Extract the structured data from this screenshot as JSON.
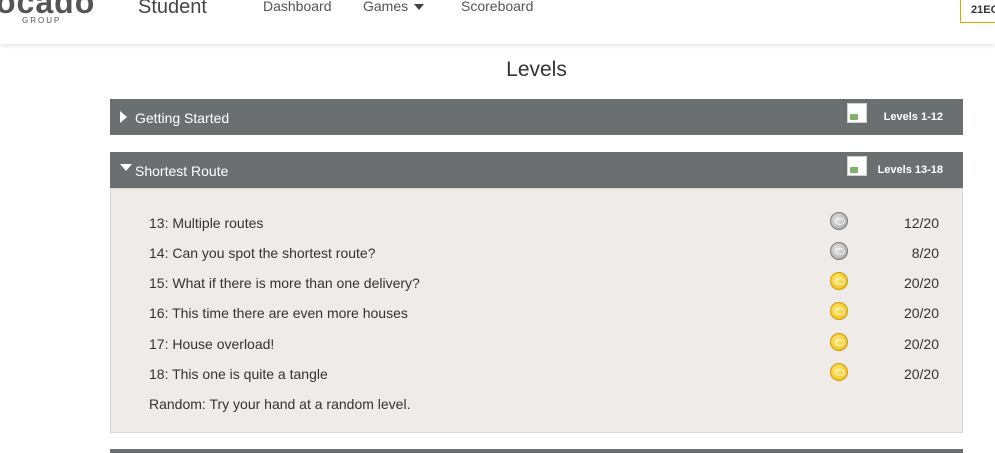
{
  "header": {
    "logo_text": "ocado",
    "logo_sub": "GROUP",
    "role": "Student",
    "nav": {
      "dashboard": "Dashboard",
      "games": "Games",
      "scoreboard": "Scoreboard"
    },
    "user_code": "21EC"
  },
  "page_title": "Levels",
  "episodes": [
    {
      "title": "Getting Started",
      "range": "Levels 1-12",
      "expanded": false
    },
    {
      "title": "Shortest Route",
      "range": "Levels 13-18",
      "expanded": true
    }
  ],
  "levels": [
    {
      "name": "13: Multiple routes",
      "medal": "silver",
      "score": "12/20"
    },
    {
      "name": "14: Can you spot the shortest route?",
      "medal": "silver",
      "score": "8/20"
    },
    {
      "name": "15: What if there is more than one delivery?",
      "medal": "gold",
      "score": "20/20"
    },
    {
      "name": "16: This time there are even more houses",
      "medal": "gold",
      "score": "20/20"
    },
    {
      "name": "17: House overload!",
      "medal": "gold",
      "score": "20/20"
    },
    {
      "name": "18: This one is quite a tangle",
      "medal": "gold",
      "score": "20/20"
    }
  ],
  "random_level": "Random: Try your hand at a random level.",
  "colors": {
    "panel_header": "#6c6f70",
    "panel_body": "#efebe9",
    "gold": "#f0b800",
    "silver": "#9a9a9a"
  }
}
